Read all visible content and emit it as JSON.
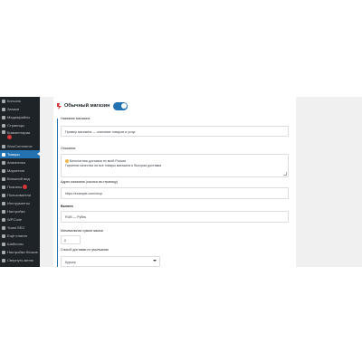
{
  "sidebar": {
    "items": [
      {
        "label": "Консоль",
        "icon": "dashboard-icon"
      },
      {
        "label": "Записи",
        "icon": "pin-icon"
      },
      {
        "label": "Медиафайлы",
        "icon": "media-icon"
      },
      {
        "label": "Страницы",
        "icon": "page-icon"
      },
      {
        "label": "Комментарии",
        "icon": "comments-icon",
        "badge": true
      },
      {
        "label": "WooCommerce",
        "icon": "woocommerce-icon"
      },
      {
        "label": "Товары",
        "icon": "products-icon",
        "current": true
      },
      {
        "label": "Аналитика",
        "icon": "analytics-icon"
      },
      {
        "label": "Маркетинг",
        "icon": "marketing-icon"
      },
      {
        "label": "Внешний вид",
        "icon": "appearance-icon"
      },
      {
        "label": "Плагины",
        "icon": "plugins-icon",
        "badge": true
      },
      {
        "label": "Пользователи",
        "icon": "users-icon"
      },
      {
        "label": "Инструменты",
        "icon": "tools-icon"
      },
      {
        "label": "Настройки",
        "icon": "settings-icon"
      },
      {
        "label": "WPCode",
        "icon": "code-icon"
      },
      {
        "label": "Yoast SEO",
        "icon": "yoast-icon"
      },
      {
        "label": "Ещё плагин",
        "icon": "plugin-icon"
      },
      {
        "label": "Шаблоны",
        "icon": "templates-icon"
      },
      {
        "label": "Настройки блоков",
        "icon": "blocks-icon"
      },
      {
        "label": "Свернуть меню",
        "icon": "collapse-icon"
      }
    ]
  },
  "panel": {
    "title": "Обычный магазин",
    "toggle_on": true,
    "fields": {
      "f1_label": "Название магазина",
      "f1_value": "Пример магазина — описание товаров и услуг",
      "f2_label": "Описание",
      "f2_line1": "Бесплатная доставка по всей России",
      "f2_line2": "Гарантия качества на все товары магазина и быстрая доставка",
      "f3_label": "Адрес магазина (ссылка на страницу)",
      "f3_value": "https://example.com/shop",
      "f4_label": "Валюта",
      "f4_value": "RUB — Рубль",
      "f5_label": "Минимальная сумма заказа",
      "f5_value": "0",
      "f6_label": "Способ доставки по умолчанию",
      "f6_value": "Курьер"
    }
  },
  "colors": {
    "sidebar_bg": "#1d2327",
    "accent": "#2271b1",
    "badge": "#d63638",
    "workspace_bg": "#f0f0f1"
  }
}
